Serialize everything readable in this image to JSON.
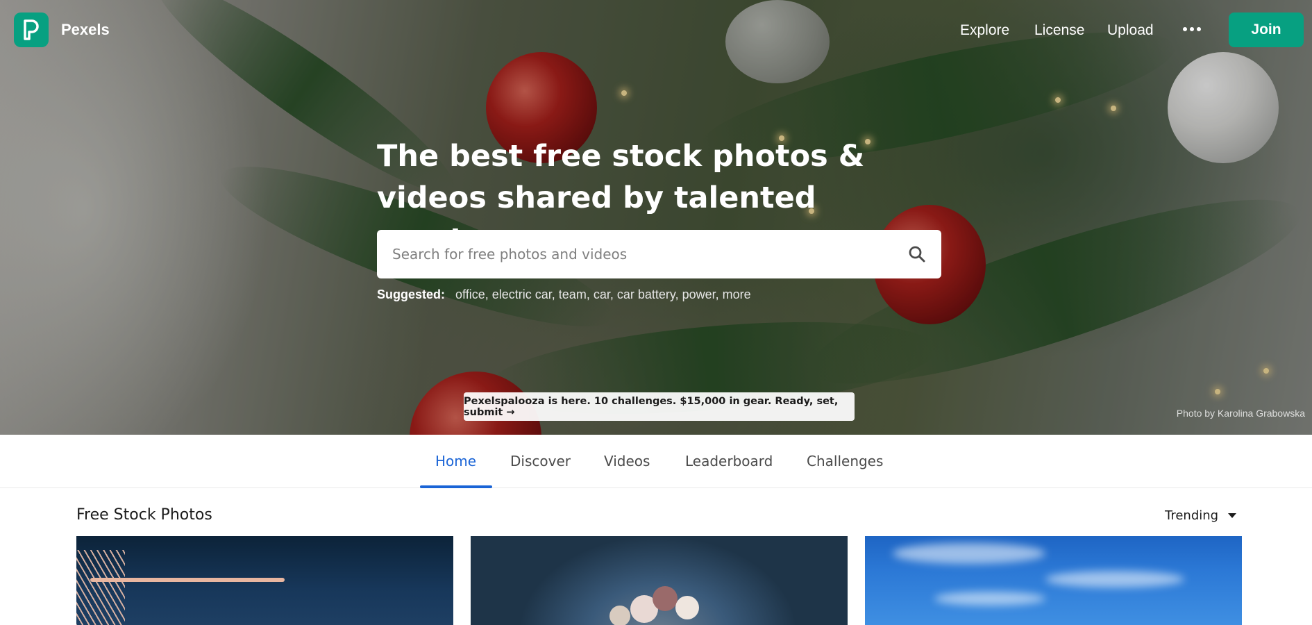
{
  "header": {
    "brand": "Pexels",
    "nav": [
      {
        "label": "Explore"
      },
      {
        "label": "License"
      },
      {
        "label": "Upload"
      }
    ],
    "join_label": "Join"
  },
  "hero": {
    "headline": "The best free stock photos & videos shared by talented creators.",
    "search_placeholder": "Search for free photos and videos",
    "suggested_label": "Suggested:",
    "suggested": [
      "office",
      "electric car",
      "team",
      "car",
      "car battery",
      "power",
      "more"
    ],
    "promo": "Pexelspalooza is here. 10 challenges. $15,000 in gear. Ready, set, submit →",
    "credit": "Photo by Karolina Grabowska"
  },
  "tabs": [
    {
      "label": "Home",
      "active": true
    },
    {
      "label": "Discover",
      "active": false
    },
    {
      "label": "Videos",
      "active": false
    },
    {
      "label": "Leaderboard",
      "active": false
    },
    {
      "label": "Challenges",
      "active": false
    }
  ],
  "main": {
    "section_title": "Free Stock Photos",
    "sort_value": "Trending"
  },
  "colors": {
    "brand": "#07a081",
    "tab_active": "#1a64d6"
  },
  "icons": [
    "pexels-logo-icon",
    "more-dots-icon",
    "search-icon",
    "chevron-down-icon"
  ]
}
